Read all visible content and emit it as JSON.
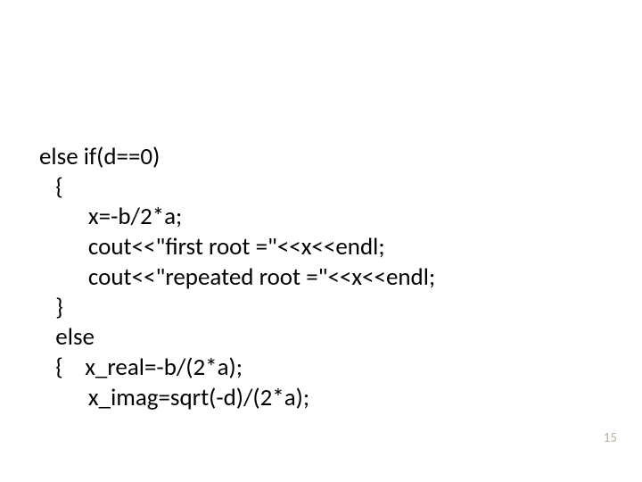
{
  "code": {
    "l1": "else if(d==0)",
    "l2": "   {",
    "l3": "         x=-b/2*a;",
    "l4": "         cout<<\"first root =\"<<x<<endl;",
    "l5": "         cout<<\"repeated root =\"<<x<<endl;",
    "l6": "   }",
    "l7": "   else",
    "l8": "   {    x_real=-b/(2*a);",
    "l9": "         x_imag=sqrt(-d)/(2*a);"
  },
  "page_number": "15"
}
